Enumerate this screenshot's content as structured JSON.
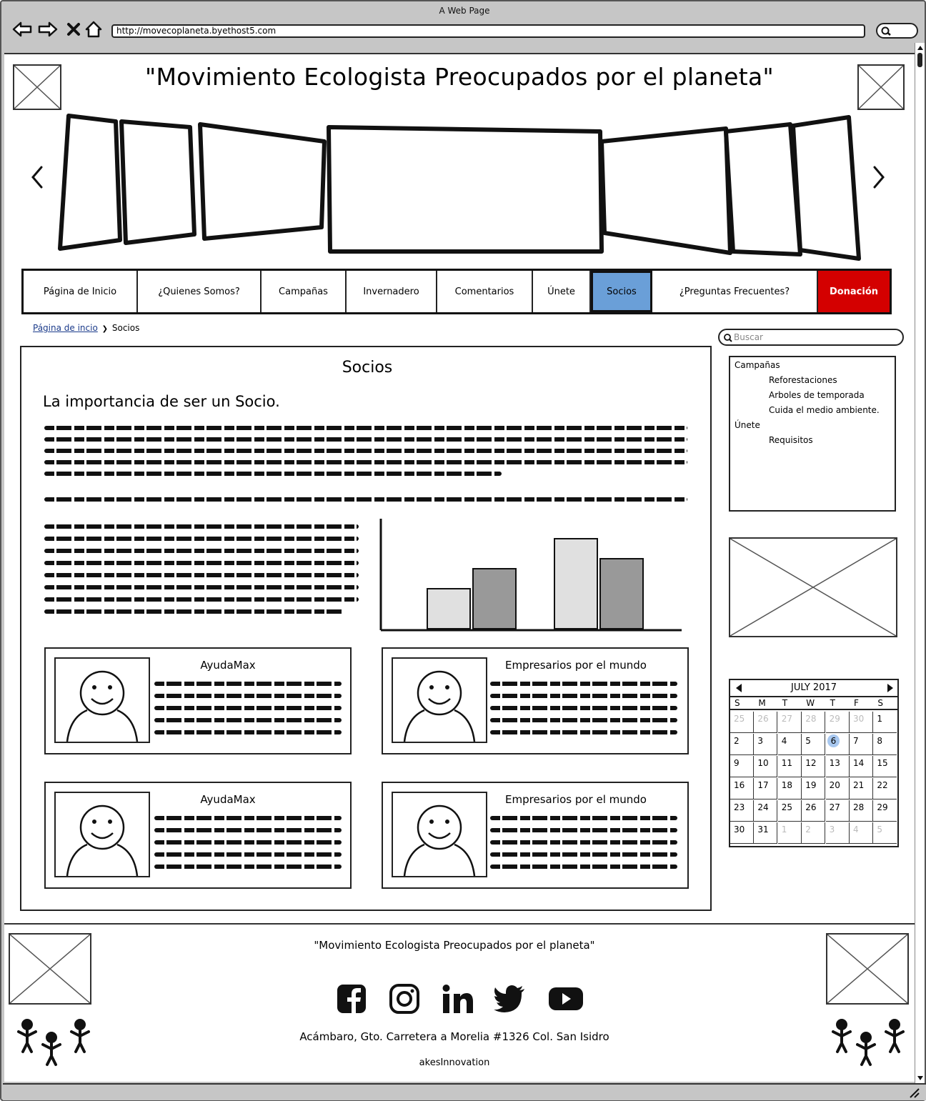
{
  "window": {
    "title": "A Web Page",
    "url": "http://movecoplaneta.byethost5.com"
  },
  "header": {
    "title": "\"Movimiento Ecologista Preocupados por el planeta\""
  },
  "nav": {
    "items": [
      {
        "label": "Página de Inicio"
      },
      {
        "label": "¿Quienes Somos?"
      },
      {
        "label": "Campañas"
      },
      {
        "label": "Invernadero"
      },
      {
        "label": "Comentarios"
      },
      {
        "label": "Únete"
      },
      {
        "label": "Socios"
      },
      {
        "label": "¿Preguntas Frecuentes?"
      },
      {
        "label": "Donación"
      }
    ],
    "active_color": "#6a9fd8",
    "donation_color": "#d40000"
  },
  "breadcrumb": {
    "home": "Página de incio",
    "current": "Socios"
  },
  "search": {
    "placeholder": "Buscar"
  },
  "main": {
    "title": "Socios",
    "heading": "La importancia de ser un Socio.",
    "chart_data": {
      "type": "bar",
      "series": [
        {
          "values": [
            2,
            4.5
          ]
        },
        {
          "values": [
            3,
            3.5
          ]
        }
      ],
      "colors": [
        "#e0e0e0",
        "#999999"
      ]
    },
    "cards": [
      {
        "title": "AyudaMax"
      },
      {
        "title": "Empresarios por el mundo"
      },
      {
        "title": "AyudaMax"
      },
      {
        "title": "Empresarios por el mundo"
      }
    ]
  },
  "sidebar": {
    "menu": [
      {
        "label": "Campañas",
        "level": 0
      },
      {
        "label": "Reforestaciones",
        "level": 1
      },
      {
        "label": "Arboles de temporada",
        "level": 1
      },
      {
        "label": "Cuida el medio ambiente.",
        "level": 1
      },
      {
        "label": "Únete",
        "level": 0
      },
      {
        "label": "Requisitos",
        "level": 1
      }
    ],
    "calendar": {
      "month_label": "JULY 2017",
      "weekdays": [
        "S",
        "M",
        "T",
        "W",
        "T",
        "F",
        "S"
      ],
      "weeks": [
        [
          "25",
          "26",
          "27",
          "28",
          "29",
          "30",
          "1"
        ],
        [
          "2",
          "3",
          "4",
          "5",
          "6",
          "7",
          "8"
        ],
        [
          "9",
          "10",
          "11",
          "12",
          "13",
          "14",
          "15"
        ],
        [
          "16",
          "17",
          "18",
          "19",
          "20",
          "21",
          "22"
        ],
        [
          "23",
          "24",
          "25",
          "26",
          "27",
          "28",
          "29"
        ],
        [
          "30",
          "31",
          "1",
          "2",
          "3",
          "4",
          "5"
        ]
      ],
      "selected": "6",
      "selected_color": "#a8c8f0"
    }
  },
  "footer": {
    "title": "\"Movimiento Ecologista Preocupados por el planeta\"",
    "address": "Acámbaro, Gto. Carretera a Morelia #1326 Col. San Isidro",
    "credit": "akesInnovation",
    "social": [
      "facebook-icon",
      "instagram-icon",
      "linkedin-icon",
      "twitter-icon",
      "youtube-icon"
    ]
  }
}
